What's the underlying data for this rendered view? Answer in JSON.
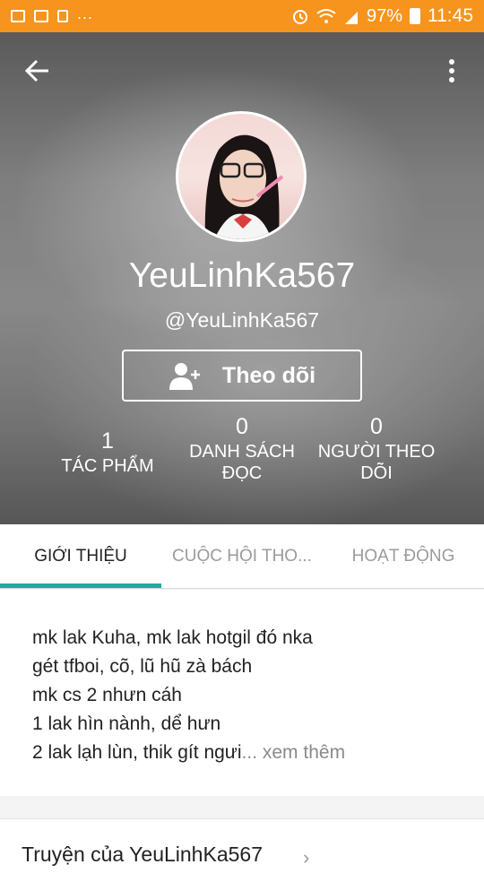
{
  "status_bar": {
    "dots": "...",
    "battery": "97%",
    "time": "11:45"
  },
  "profile": {
    "display_name": "YeuLinhKa567",
    "handle": "@YeuLinhKa567",
    "follow_label": "Theo dõi",
    "stats": [
      {
        "value": "1",
        "label_line1": "TÁC PHẨM",
        "label_line2": ""
      },
      {
        "value": "0",
        "label_line1": "DANH SÁCH",
        "label_line2": "ĐỌC"
      },
      {
        "value": "0",
        "label_line1": "NGƯỜI THEO",
        "label_line2": "DÕI"
      }
    ]
  },
  "tabs": [
    {
      "label": "GIỚI THIỆU",
      "active": true
    },
    {
      "label": "CUỘC HỘI THO...",
      "active": false
    },
    {
      "label": "HOẠT ĐỘNG",
      "active": false
    }
  ],
  "about": {
    "lines": [
      "mk lak Kuha, mk lak hotgil đó nka",
      "gét tfboi, cõ, lũ hũ zà bách",
      "mk cs 2 nhưn cáh",
      "1 lak hìn nành, dể hưn",
      "2 lak lạh lùn, thik gít ngưi"
    ],
    "see_more": "... xem thêm"
  },
  "stories": {
    "title": "Truyện của YeuLinhKa567"
  },
  "colors": {
    "status_bar": "#f7941d",
    "tab_indicator": "#20a9a0"
  }
}
